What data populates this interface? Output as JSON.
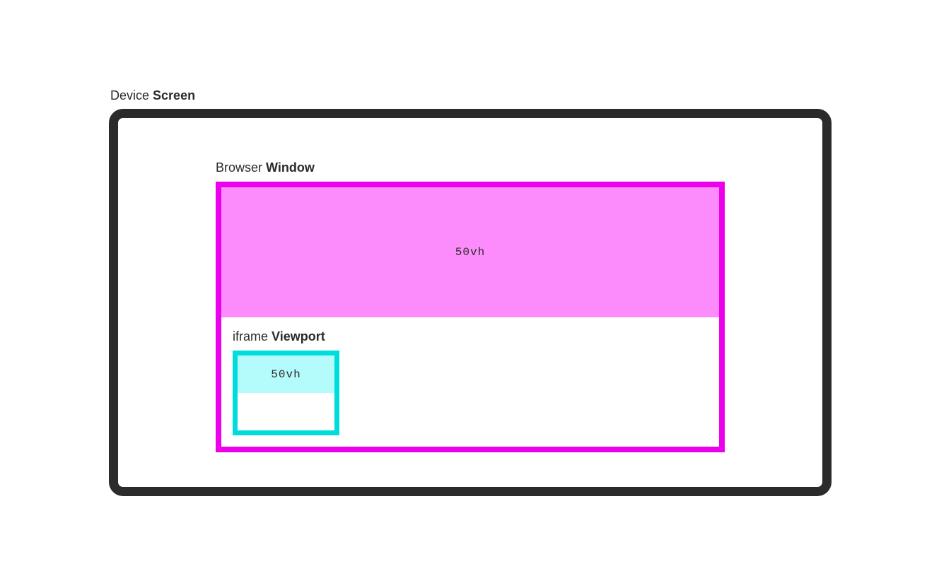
{
  "screen": {
    "label_prefix": "Device ",
    "label_bold": "Screen"
  },
  "window": {
    "label_prefix": "Browser ",
    "label_bold": "Window",
    "vh_label": "50vh"
  },
  "iframe": {
    "label_prefix": "iframe ",
    "label_bold": "Viewport",
    "vh_label": "50vh"
  },
  "colors": {
    "screen_border": "#2b2b2b",
    "window_border": "#ec00ec",
    "window_fill": "#fc8cfc",
    "iframe_border": "#00dcdc",
    "iframe_fill": "#b4fcfc"
  }
}
